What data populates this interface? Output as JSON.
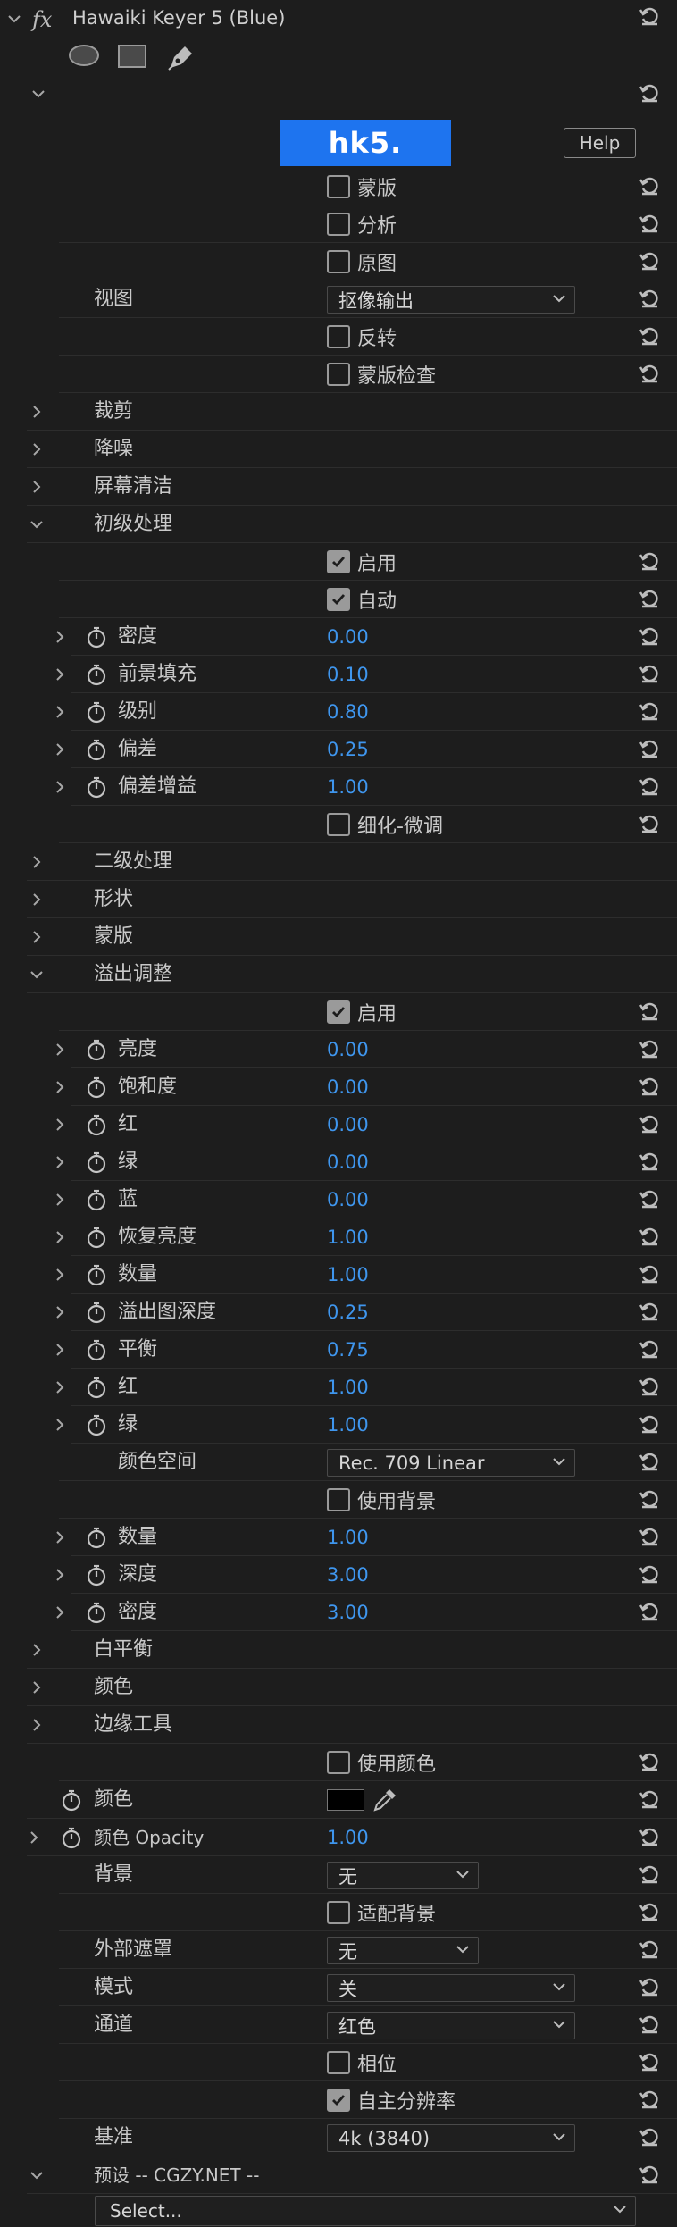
{
  "effect": {
    "fx_glyph": "fx",
    "title": "Hawaiki Keyer 5 (Blue)"
  },
  "tools": [
    "ellipse-mask-icon",
    "rectangle-mask-icon",
    "pen-mask-icon"
  ],
  "brand": {
    "logo": "hk5.",
    "help": "Help"
  },
  "rows": [
    {
      "type": "checkbox",
      "label": "蒙版",
      "checked": false
    },
    {
      "type": "checkbox",
      "label": "分析",
      "checked": false
    },
    {
      "type": "checkbox",
      "label": "原图",
      "checked": false
    },
    {
      "type": "dropdown",
      "label": "视图",
      "value": "抠像输出",
      "width": "wide"
    },
    {
      "type": "checkbox",
      "label": "反转",
      "checked": false
    },
    {
      "type": "checkbox",
      "label": "蒙版检查",
      "checked": false
    },
    {
      "type": "section",
      "label": "裁剪",
      "expanded": false
    },
    {
      "type": "section",
      "label": "降噪",
      "expanded": false
    },
    {
      "type": "section",
      "label": "屏幕清洁",
      "expanded": false
    },
    {
      "type": "section",
      "label": "初级处理",
      "expanded": true
    },
    {
      "type": "checkbox",
      "label": "启用",
      "checked": true
    },
    {
      "type": "checkbox",
      "label": "自动",
      "checked": true
    },
    {
      "type": "param",
      "label": "密度",
      "value": "0.00"
    },
    {
      "type": "param",
      "label": "前景填充",
      "value": "0.10"
    },
    {
      "type": "param",
      "label": "级别",
      "value": "0.80"
    },
    {
      "type": "param",
      "label": "偏差",
      "value": "0.25"
    },
    {
      "type": "param",
      "label": "偏差增益",
      "value": "1.00"
    },
    {
      "type": "checkbox",
      "label": "细化-微调",
      "checked": false
    },
    {
      "type": "section",
      "label": "二级处理",
      "expanded": false
    },
    {
      "type": "section",
      "label": "形状",
      "expanded": false
    },
    {
      "type": "section",
      "label": "蒙版",
      "expanded": false
    },
    {
      "type": "section",
      "label": "溢出调整",
      "expanded": true
    },
    {
      "type": "checkbox",
      "label": "启用",
      "checked": true
    },
    {
      "type": "param",
      "label": "亮度",
      "value": "0.00"
    },
    {
      "type": "param",
      "label": "饱和度",
      "value": "0.00"
    },
    {
      "type": "param",
      "label": "红",
      "value": "0.00"
    },
    {
      "type": "param",
      "label": "绿",
      "value": "0.00"
    },
    {
      "type": "param",
      "label": "蓝",
      "value": "0.00"
    },
    {
      "type": "param",
      "label": "恢复亮度",
      "value": "1.00"
    },
    {
      "type": "param",
      "label": "数量",
      "value": "1.00"
    },
    {
      "type": "param",
      "label": "溢出图深度",
      "value": "0.25"
    },
    {
      "type": "param",
      "label": "平衡",
      "value": "0.75"
    },
    {
      "type": "param",
      "label": "红",
      "value": "1.00"
    },
    {
      "type": "param",
      "label": "绿",
      "value": "1.00"
    },
    {
      "type": "dropdown",
      "label": "颜色空间",
      "value": "Rec. 709 Linear",
      "width": "wide",
      "indent": true
    },
    {
      "type": "checkbox",
      "label": "使用背景",
      "checked": false
    },
    {
      "type": "param",
      "label": "数量",
      "value": "1.00"
    },
    {
      "type": "param",
      "label": "深度",
      "value": "3.00"
    },
    {
      "type": "param",
      "label": "密度",
      "value": "3.00"
    },
    {
      "type": "section",
      "label": "白平衡",
      "expanded": false
    },
    {
      "type": "section",
      "label": "颜色",
      "expanded": false
    },
    {
      "type": "section",
      "label": "边缘工具",
      "expanded": false
    },
    {
      "type": "checkbox",
      "label": "使用颜色",
      "checked": false
    },
    {
      "type": "color",
      "label": "颜色",
      "swatch": "#000000"
    },
    {
      "type": "top-param",
      "label": "颜色 Opacity",
      "value": "1.00"
    },
    {
      "type": "dropdown",
      "label": "背景",
      "value": "无",
      "width": "narrow"
    },
    {
      "type": "checkbox",
      "label": "适配背景",
      "checked": false
    },
    {
      "type": "dropdown",
      "label": "外部遮罩",
      "value": "无",
      "width": "narrow"
    },
    {
      "type": "dropdown",
      "label": "模式",
      "value": "关",
      "width": "wide"
    },
    {
      "type": "dropdown",
      "label": "通道",
      "value": "红色",
      "width": "wide"
    },
    {
      "type": "checkbox",
      "label": "相位",
      "checked": false
    },
    {
      "type": "checkbox",
      "label": "自主分辨率",
      "checked": true
    },
    {
      "type": "dropdown",
      "label": "基准",
      "value": "4k (3840)",
      "width": "wide"
    },
    {
      "type": "section",
      "label": "预设   -- CGZY.NET --",
      "expanded": true,
      "small": true
    }
  ],
  "preset_select": "Select..."
}
